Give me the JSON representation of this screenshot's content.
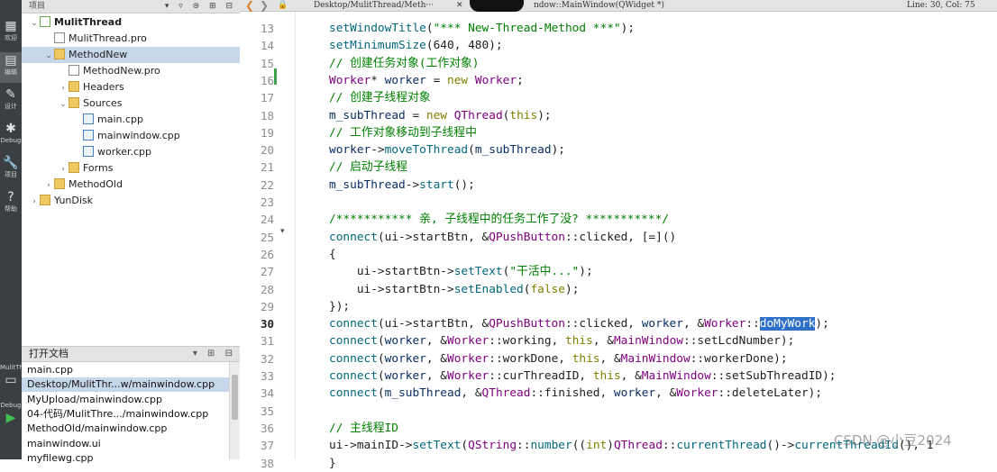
{
  "project_panel": {
    "title": "项目",
    "tree": [
      {
        "label": "MulitThread",
        "kind": "qt",
        "level": 0,
        "expanded": true,
        "bold": true
      },
      {
        "label": "MulitThread.pro",
        "kind": "pro",
        "level": 1
      },
      {
        "label": "MethodNew",
        "kind": "folder",
        "level": 1,
        "expanded": true,
        "selected": true
      },
      {
        "label": "MethodNew.pro",
        "kind": "pro",
        "level": 2
      },
      {
        "label": "Headers",
        "kind": "folder",
        "level": 2,
        "expanded": false
      },
      {
        "label": "Sources",
        "kind": "folder",
        "level": 2,
        "expanded": true
      },
      {
        "label": "main.cpp",
        "kind": "cpp",
        "level": 3
      },
      {
        "label": "mainwindow.cpp",
        "kind": "cpp",
        "level": 3
      },
      {
        "label": "worker.cpp",
        "kind": "cpp",
        "level": 3
      },
      {
        "label": "Forms",
        "kind": "folder",
        "level": 2,
        "expanded": false
      },
      {
        "label": "MethodOld",
        "kind": "folder",
        "level": 1,
        "expanded": false
      },
      {
        "label": "YunDisk",
        "kind": "folder",
        "level": 0,
        "expanded": false
      }
    ]
  },
  "modes": [
    {
      "icon": "welcome-icon",
      "label": "欢迎"
    },
    {
      "icon": "edit-icon",
      "label": "编辑"
    },
    {
      "icon": "design-icon",
      "label": "设计"
    },
    {
      "icon": "debug-icon",
      "label": "Debug"
    },
    {
      "icon": "projects-icon",
      "label": "项目"
    },
    {
      "icon": "help-icon",
      "label": "帮助"
    }
  ],
  "bottom_modes": [
    {
      "icon": "kit-icon",
      "label": "MulitThread"
    },
    {
      "icon": "run-icon",
      "label": "Debug"
    }
  ],
  "open_docs": {
    "title": "打开文档",
    "items": [
      {
        "label": "main.cpp"
      },
      {
        "label": "Desktop/MulitThr...w/mainwindow.cpp",
        "selected": true
      },
      {
        "label": "MyUpload/mainwindow.cpp"
      },
      {
        "label": "04-代码/MulitThre.../mainwindow.cpp"
      },
      {
        "label": "MethodOld/mainwindow.cpp"
      },
      {
        "label": "mainwindow.ui"
      },
      {
        "label": "myfilewg.cpp"
      }
    ]
  },
  "editor": {
    "file_path": "Desktop/MulitThread/Meth···",
    "symbol": "ndow::MainWindow(QWidget *)",
    "position": "Line: 30, Col: 75",
    "current_line": 30,
    "lines": [
      {
        "n": 13,
        "code": "    setWindowTitle(\"*** New-Thread-Method ***\");"
      },
      {
        "n": 14,
        "code": "    setMinimumSize(640, 480);"
      },
      {
        "n": 15,
        "code": "    // 创建任务对象(工作对象)"
      },
      {
        "n": 16,
        "code": "    Worker* worker = new Worker;"
      },
      {
        "n": 17,
        "code": "    // 创建子线程对象"
      },
      {
        "n": 18,
        "code": "    m_subThread = new QThread(this);"
      },
      {
        "n": 19,
        "code": "    // 工作对象移动到子线程中"
      },
      {
        "n": 20,
        "code": "    worker->moveToThread(m_subThread);"
      },
      {
        "n": 21,
        "code": "    // 启动子线程"
      },
      {
        "n": 22,
        "code": "    m_subThread->start();"
      },
      {
        "n": 23,
        "code": ""
      },
      {
        "n": 24,
        "code": "    /*********** 亲, 子线程中的任务工作了没? ***********/"
      },
      {
        "n": 25,
        "code": "    connect(ui->startBtn, &QPushButton::clicked, [=]()"
      },
      {
        "n": 26,
        "code": "    {"
      },
      {
        "n": 27,
        "code": "        ui->startBtn->setText(\"干活中...\");"
      },
      {
        "n": 28,
        "code": "        ui->startBtn->setEnabled(false);"
      },
      {
        "n": 29,
        "code": "    });"
      },
      {
        "n": 30,
        "code": "    connect(ui->startBtn, &QPushButton::clicked, worker, &Worker::doMyWork);"
      },
      {
        "n": 31,
        "code": "    connect(worker, &Worker::working, this, &MainWindow::setLcdNumber);"
      },
      {
        "n": 32,
        "code": "    connect(worker, &Worker::workDone, this, &MainWindow::workerDone);"
      },
      {
        "n": 33,
        "code": "    connect(worker, &Worker::curThreadID, this, &MainWindow::setSubThreadID);"
      },
      {
        "n": 34,
        "code": "    connect(m_subThread, &QThread::finished, worker, &Worker::deleteLater);"
      },
      {
        "n": 35,
        "code": ""
      },
      {
        "n": 36,
        "code": "    // 主线程ID"
      },
      {
        "n": 37,
        "code": "    ui->mainID->setText(QString::number((int)QThread::currentThread()->currentThreadId(), 1"
      },
      {
        "n": 38,
        "code": "}"
      }
    ],
    "selection": "doMyWork"
  },
  "watermark": "CSDN @小豆2024"
}
